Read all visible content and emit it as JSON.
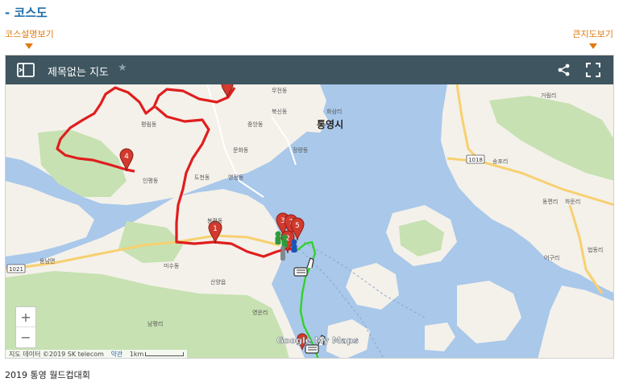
{
  "section": {
    "title": "- 코스도"
  },
  "toggles": {
    "left": "코스설명보기",
    "right": "큰지도보기"
  },
  "map": {
    "title": "제목없는 지도",
    "icons": {
      "panel": "side-panel-icon",
      "star": "star-icon",
      "share": "share-icon",
      "fullscreen": "fullscreen-icon",
      "zoom_in": "plus-icon",
      "zoom_out": "minus-icon"
    },
    "zoom_in_label": "+",
    "zoom_out_label": "−",
    "labels": {
      "city": "통영시",
      "muchun": "무전동",
      "buksin": "북신동",
      "hwasam": "화삼리",
      "jungang": "중앙동",
      "jeongnyang": "정량동",
      "munhwa": "문화동",
      "inpyeong": "인평동",
      "dochen": "도천동",
      "myeongjeong": "명정동",
      "pyeongrim": "평림동",
      "bongpyeong": "봉평동",
      "misu": "미수동",
      "yongnam": "용남면",
      "yeongun": "영운리",
      "sanyang": "산양읍",
      "namjeong": "남평리",
      "geoje": "거림리",
      "seongnae": "송포리",
      "jonggyo": "동편리",
      "hado": "하둔리",
      "beopdong": "법동리",
      "eoguri": "어구리",
      "road_1021": "1021",
      "road_1018": "1018"
    },
    "markers": [
      "1",
      "2",
      "3",
      "4",
      "5",
      "7"
    ],
    "attribution": "지도 데이터 ©2019 SK telecom",
    "terms": "약관",
    "scale": "1km",
    "google": "Google My Maps"
  },
  "caption": "2019 통영 월드컵대회",
  "colors": {
    "accent_blue": "#1f6fa8",
    "accent_orange": "#e07a10",
    "header_bg": "#3f5560",
    "route_red": "#e01e1e",
    "route_green": "#34d12a",
    "water": "#a9c8ea",
    "land": "#f4f1ea",
    "park": "#c7e1b2"
  }
}
